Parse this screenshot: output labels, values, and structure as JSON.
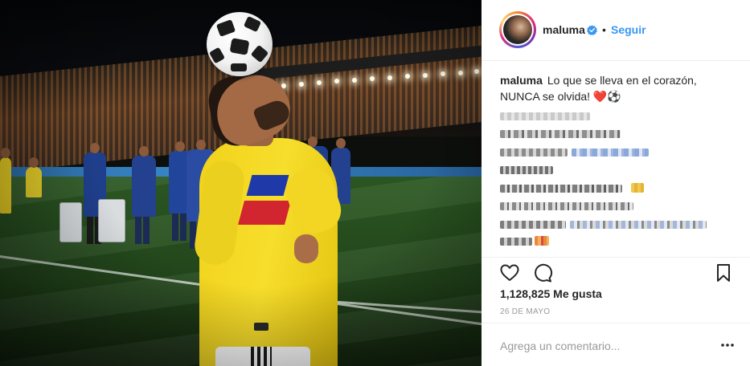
{
  "post": {
    "username": "maluma",
    "separator": "•",
    "follow_label": "Seguir",
    "caption_user": "maluma",
    "caption_text": "Lo que se lleva en el corazón, NUNCA se olvida! ❤️⚽",
    "likes": "1,128,825 Me gusta",
    "date": "26 DE MAYO",
    "comment_placeholder": "Agrega un comentario..."
  },
  "icons": {
    "verified": "verified-badge-icon",
    "like": "heart-icon",
    "comment": "comment-icon",
    "save": "bookmark-icon",
    "more": "more-options-icon"
  },
  "colors": {
    "link_blue": "#3897f0",
    "text": "#262626",
    "muted": "#999999",
    "divider": "#efefef"
  }
}
